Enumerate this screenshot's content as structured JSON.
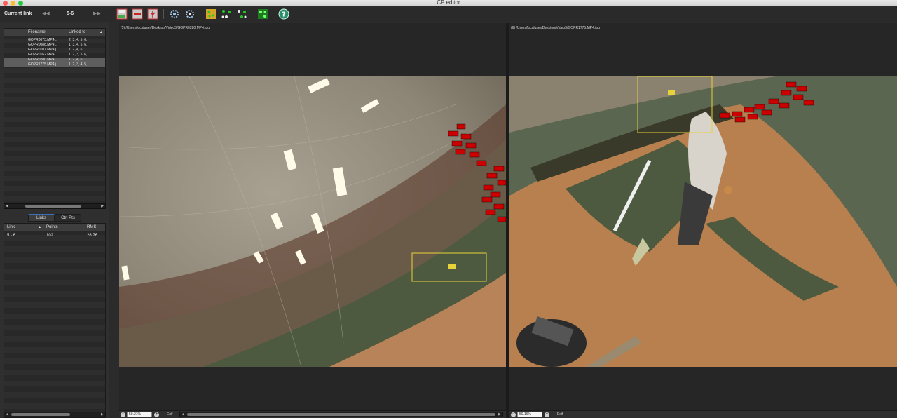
{
  "window": {
    "title": "CP editor"
  },
  "current_link": {
    "label": "Current link",
    "value": "5-6",
    "prev_icon": "rewind-icon",
    "next_icon": "fast-forward-icon"
  },
  "files_table": {
    "columns": [
      "Filename",
      "Linked to"
    ],
    "rows": [
      {
        "filename": "GOPR0073.MP4...",
        "linked": "2, 3, 4, 5, 6,",
        "selected": false
      },
      {
        "filename": "GOPR0088.MP4...",
        "linked": "1, 3, 4, 5, 6,",
        "selected": false
      },
      {
        "filename": "GOPR0107.MP4 j...",
        "linked": "1, 2, 4, 6,",
        "selected": false
      },
      {
        "filename": "GOPR0162.MP4...",
        "linked": "1, 2, 3, 5, 6,",
        "selected": false
      },
      {
        "filename": "GOPR0280.MP4...",
        "linked": "1, 2, 4, 6,",
        "selected": true
      },
      {
        "filename": "GOPR1775.MP4 j...",
        "linked": "1, 2, 3, 4, 5,",
        "selected": true
      }
    ]
  },
  "tabs": [
    {
      "label": "Links",
      "active": true
    },
    {
      "label": "Ctrl Pts",
      "active": false
    }
  ],
  "links_table": {
    "columns": [
      "Link",
      "Points",
      "RMS"
    ],
    "rows": [
      {
        "link": "5 - 6",
        "points": "102",
        "rms": "26.76"
      }
    ]
  },
  "toolbar": {
    "buttons": [
      "save-icon",
      "delete-icon",
      "cut-icon",
      "gear-icon",
      "gear-alt-icon",
      "add-points-icon",
      "optimize-icon",
      "optimize-alt-icon",
      "network-icon",
      "help-icon"
    ]
  },
  "left_image": {
    "path": "(5) /Users/localuser/Desktop/Video3/GOPR0280.MP4.jpg",
    "zoom": "50.21%",
    "exif_label": "Exif"
  },
  "right_image": {
    "path": "(6) /Users/localuser/Desktop/Video3/GOPR1775.MP4.jpg",
    "zoom": "50.16%",
    "exif_label": "Exif"
  },
  "colors": {
    "accent": "#3b6fb5",
    "marker": "#cc0000",
    "selection_box": "#e6d23a"
  }
}
